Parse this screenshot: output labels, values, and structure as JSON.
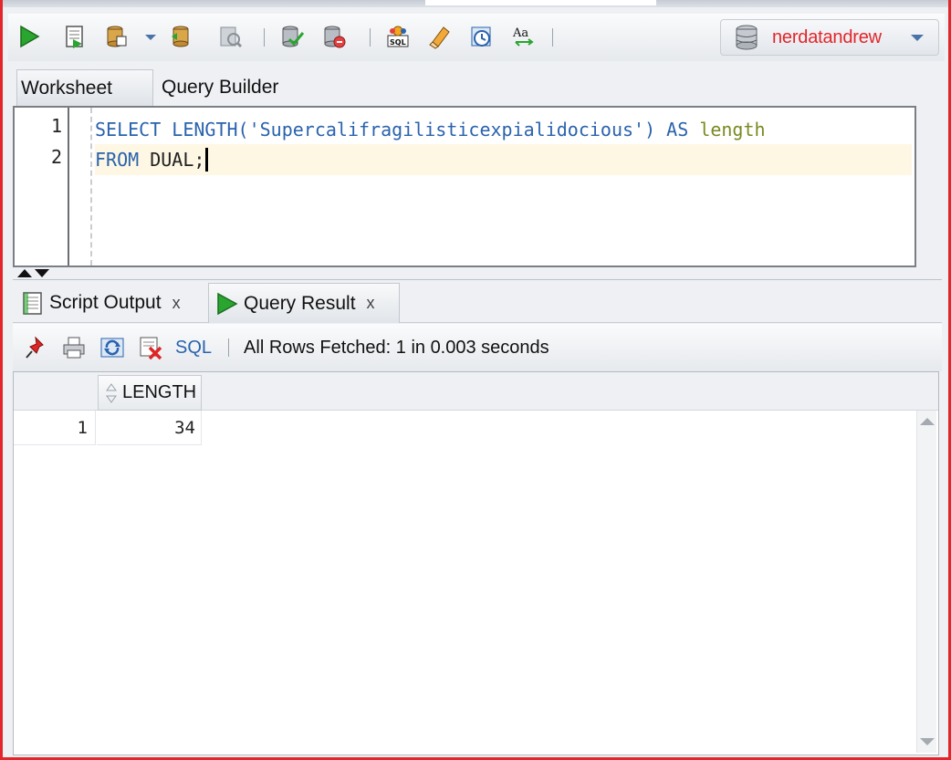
{
  "toolbar": {
    "buttons": [
      {
        "icon": "run-statement-icon"
      },
      {
        "icon": "run-script-icon"
      },
      {
        "icon": "commit-icon"
      },
      {
        "icon": "dropdown-icon"
      },
      {
        "icon": "rollback-icon"
      },
      {
        "icon": "autotrace-icon"
      },
      {
        "icon": "sql-tuning-icon"
      },
      {
        "icon": "explain-plan-icon"
      },
      {
        "icon": "sql-history-icon"
      },
      {
        "icon": "clear-icon"
      },
      {
        "icon": "timer-icon"
      },
      {
        "icon": "change-case-icon"
      }
    ],
    "connection": {
      "label": "nerdatandrew"
    }
  },
  "editor_tabs": [
    "Worksheet",
    "Query Builder"
  ],
  "editor": {
    "lines": [
      {
        "no": "1",
        "tokens": {
          "kw1": "SELECT",
          "fn": "LENGTH(",
          "str": "'Supercalifragilisticexpialidocious'",
          "close": ")",
          "kw2": "AS",
          "alias": "length"
        }
      },
      {
        "no": "2",
        "tokens": {
          "kw1": "FROM",
          "rest": "DUAL;"
        }
      }
    ]
  },
  "output_tabs": [
    {
      "label": "Script Output",
      "close": "x"
    },
    {
      "label": "Query Result",
      "close": "x"
    }
  ],
  "result_toolbar": {
    "sql_label": "SQL",
    "status": "All Rows Fetched: 1 in 0.003 seconds"
  },
  "grid": {
    "columns": [
      "LENGTH"
    ],
    "rows": [
      {
        "row_no": "1",
        "values": [
          "34"
        ]
      }
    ]
  },
  "colors": {
    "accent_border": "#e3262b",
    "keyword": "#2a63ad",
    "alias": "#7a8a20"
  }
}
